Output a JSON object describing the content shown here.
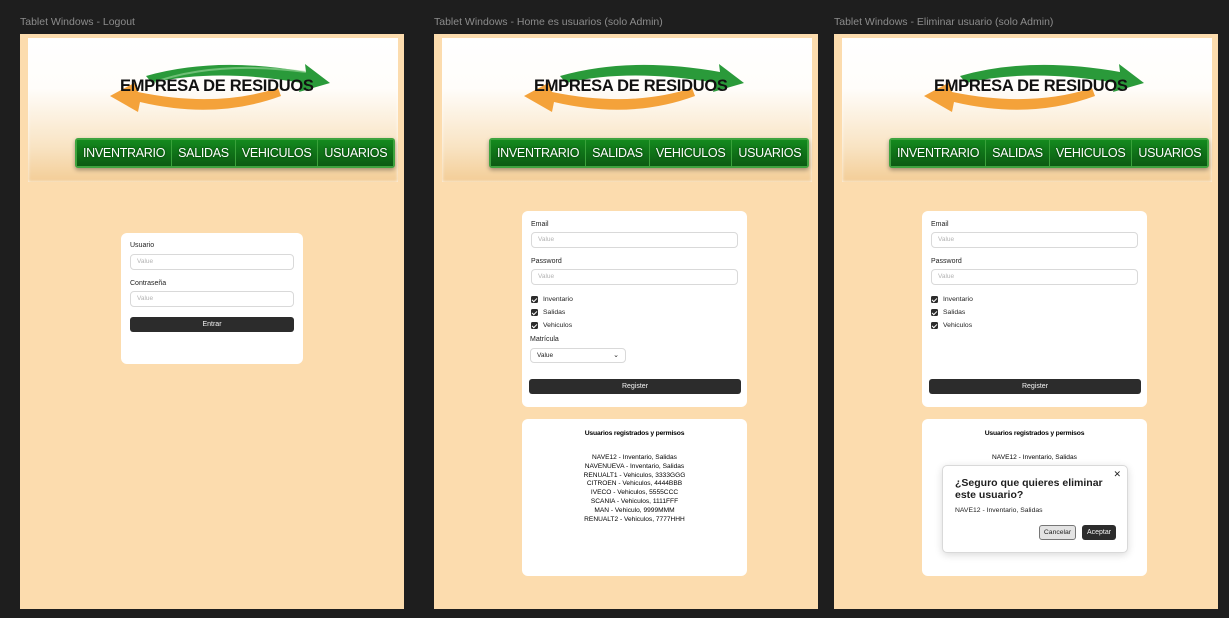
{
  "brand": {
    "name": "EMPRESA DE RESIDUOS",
    "arrow_green": "#2a9a3a",
    "arrow_orange": "#f4a23a"
  },
  "nav": [
    "INVENTRARIO",
    "SALIDAS",
    "VEHICULOS",
    "USUARIOS"
  ],
  "frames": {
    "logout": {
      "title": "Tablet Windows - Logout",
      "usuario_label": "Usuario",
      "usuario_placeholder": "Value",
      "password_label": "Contraseña",
      "password_placeholder": "Value",
      "submit": "Entrar"
    },
    "home": {
      "title": "Tablet Windows - Home es usuarios (solo Admin)",
      "email_label": "Email",
      "email_placeholder": "Value",
      "password_label": "Password",
      "password_placeholder": "Value",
      "checks": [
        "Inventario",
        "Salidas",
        "Vehiculos"
      ],
      "matricula_label": "Matrícula",
      "matricula_value": "Value",
      "register": "Register",
      "list_title": "Usuarios registrados y permisos",
      "users": [
        "NAVE12 - Inventario, Salidas",
        "NAVENUEVA - Inventario, Salidas",
        "RENUALT1 - Vehiculos, 3333GGG",
        "CITROEN - Vehiculos, 4444BBB",
        "IVECO - Vehiculos, 5555CCC",
        "SCANIA - Vehiculos, 1111FFF",
        "MAN - Vehiculo, 9999MMM",
        "RENUALT2 - Vehiculos, 7777HHH"
      ]
    },
    "delete": {
      "title": "Tablet Windows - Eliminar usuario (solo Admin)",
      "email_label": "Email",
      "email_placeholder": "Value",
      "password_label": "Password",
      "password_placeholder": "Value",
      "checks": [
        "Inventario",
        "Salidas",
        "Vehiculos"
      ],
      "register": "Register",
      "list_title": "Usuarios registrados y permisos",
      "users": [
        "NAVE12 - Inventario, Salidas"
      ],
      "dialog": {
        "title": "¿Seguro que quieres eliminar este usuario?",
        "body": "NAVE12 - Inventario, Salidas",
        "cancel": "Cancelar",
        "accept": "Aceptar",
        "close_icon": "close-icon"
      }
    }
  }
}
